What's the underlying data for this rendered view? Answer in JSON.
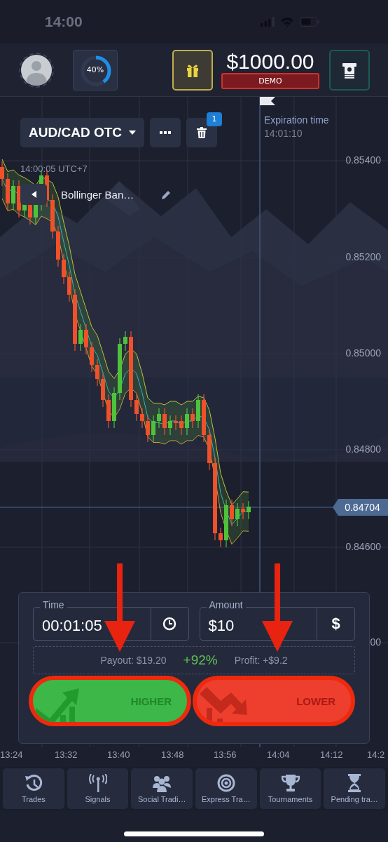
{
  "status_bar": {
    "time": "14:00"
  },
  "header": {
    "progress": {
      "label": "40%",
      "level": 0.4
    },
    "balance": {
      "amount": "$1000.00",
      "account": "DEMO"
    }
  },
  "toolbar": {
    "asset": "AUD/CAD OTC",
    "delete_badge": "1"
  },
  "chart": {
    "server_time": "14:00:05 UTC+7",
    "indicator": "Bollinger Ban…",
    "expiration": {
      "label": "Expiration time",
      "time": "14:01:10"
    },
    "price_labels": [
      "0.85400",
      "0.85200",
      "0.85000",
      "0.84800",
      "0.84600",
      "00"
    ],
    "current_price": "0.84704",
    "time_labels": [
      "13:24",
      "13:32",
      "13:40",
      "13:48",
      "13:56",
      "14:04",
      "14:12",
      "14:2"
    ]
  },
  "trade_panel": {
    "time": {
      "label": "Time",
      "value": "00:01:05"
    },
    "amount": {
      "label": "Amount",
      "value": "$10",
      "currency": "$"
    },
    "payout": "Payout: $19.20",
    "percent": "+92%",
    "profit": "Profit: +$9.2",
    "buttons": [
      {
        "kind": "higher",
        "label": "HIGHER"
      },
      {
        "kind": "lower",
        "label": "LOWER"
      }
    ]
  },
  "nav": [
    {
      "label": "Trades"
    },
    {
      "label": "Signals"
    },
    {
      "label": "Social Tradi…"
    },
    {
      "label": "Express Tra…"
    },
    {
      "label": "Tournaments"
    },
    {
      "label": "Pending tra…"
    }
  ]
}
